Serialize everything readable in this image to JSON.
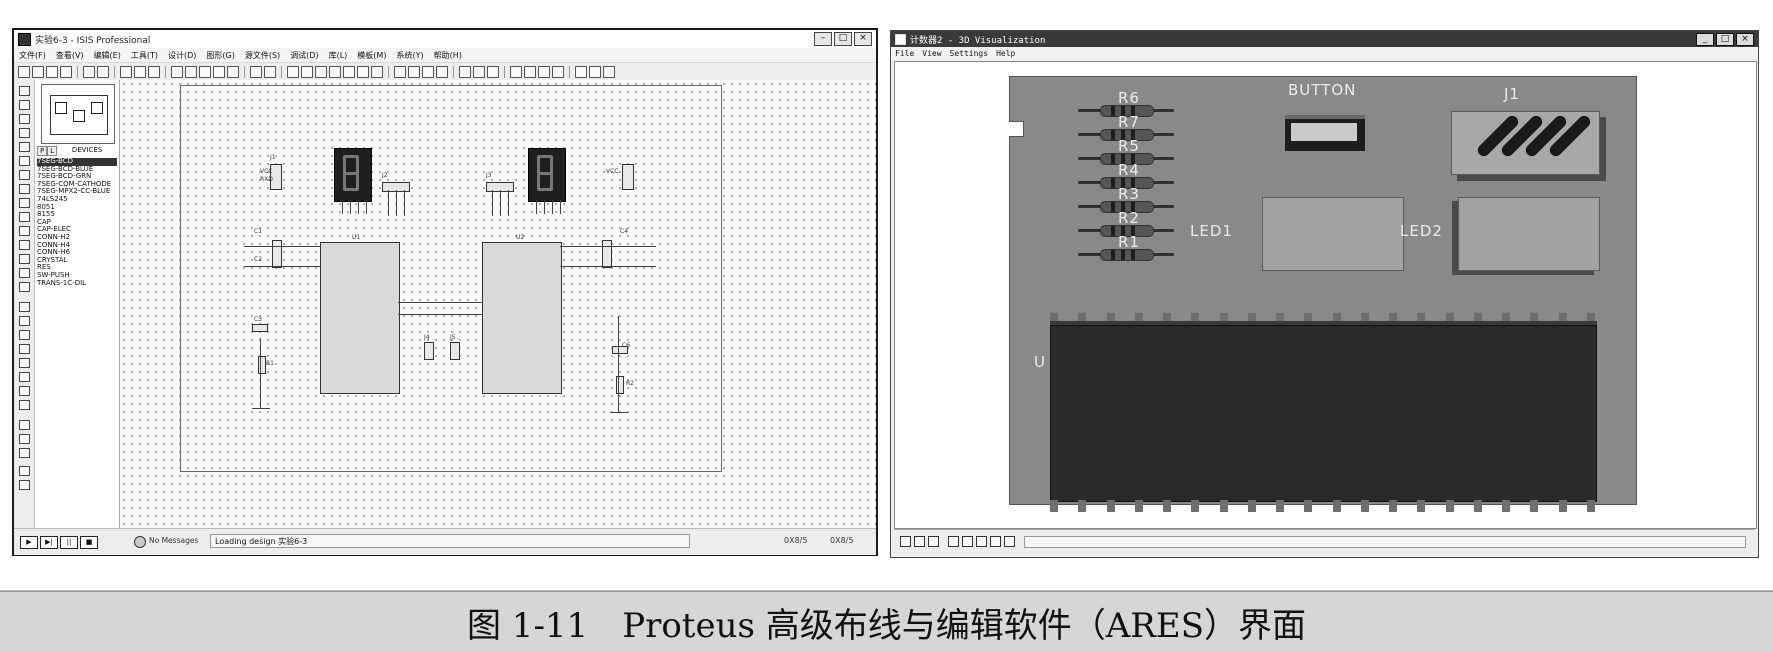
{
  "isis": {
    "title": "实验6-3 - ISIS Professional",
    "menu": [
      "文件(F)",
      "查看(V)",
      "编辑(E)",
      "工具(T)",
      "设计(D)",
      "图形(G)",
      "源文件(S)",
      "调试(D)",
      "库(L)",
      "模板(M)",
      "系统(Y)",
      "帮助(H)"
    ],
    "device_panel": {
      "tab_p": "P",
      "tab_l": "L",
      "header": "DEVICES",
      "items": [
        "7SEG-BCD",
        "7SEG-BCD-BLUE",
        "7SEG-BCD-GRN",
        "7SEG-COM-CATHODE",
        "7SEG-MPX2-CC-BLUE",
        "74LS245",
        "8051",
        "8155",
        "CAP",
        "CAP-ELEC",
        "CONN-H2",
        "CONN-H4",
        "CONN-H6",
        "CRYSTAL",
        "RES",
        "SW-PUSH",
        "TRANS-1C-DIL"
      ]
    },
    "canvas_labels": [
      "J1",
      "J2",
      "J3",
      "J4",
      "J5",
      "U1",
      "U2",
      "C1",
      "C2",
      "C3",
      "C4",
      "C5",
      "C6",
      "R1",
      "R2",
      "X1",
      "X2",
      "VCC",
      "RXD",
      "TXD"
    ],
    "status": {
      "messages_label": "No Messages",
      "loading_text": "Loading design 实验6-3",
      "coord_x": "0X8/5",
      "coord_y": "0X8/5"
    }
  },
  "viz": {
    "title": "计数器2 - 3D Visualization",
    "menu": [
      "File",
      "View",
      "Settings",
      "Help"
    ],
    "resistors": [
      "R6",
      "R7",
      "R5",
      "R4",
      "R3",
      "R2",
      "R1"
    ],
    "button_label": "BUTTON",
    "header_label": "J1",
    "led1_label": "LED1",
    "led2_label": "LED2",
    "mcu_label": "U"
  },
  "caption": "图 1-11　Proteus 高级布线与编辑软件（ARES）界面"
}
